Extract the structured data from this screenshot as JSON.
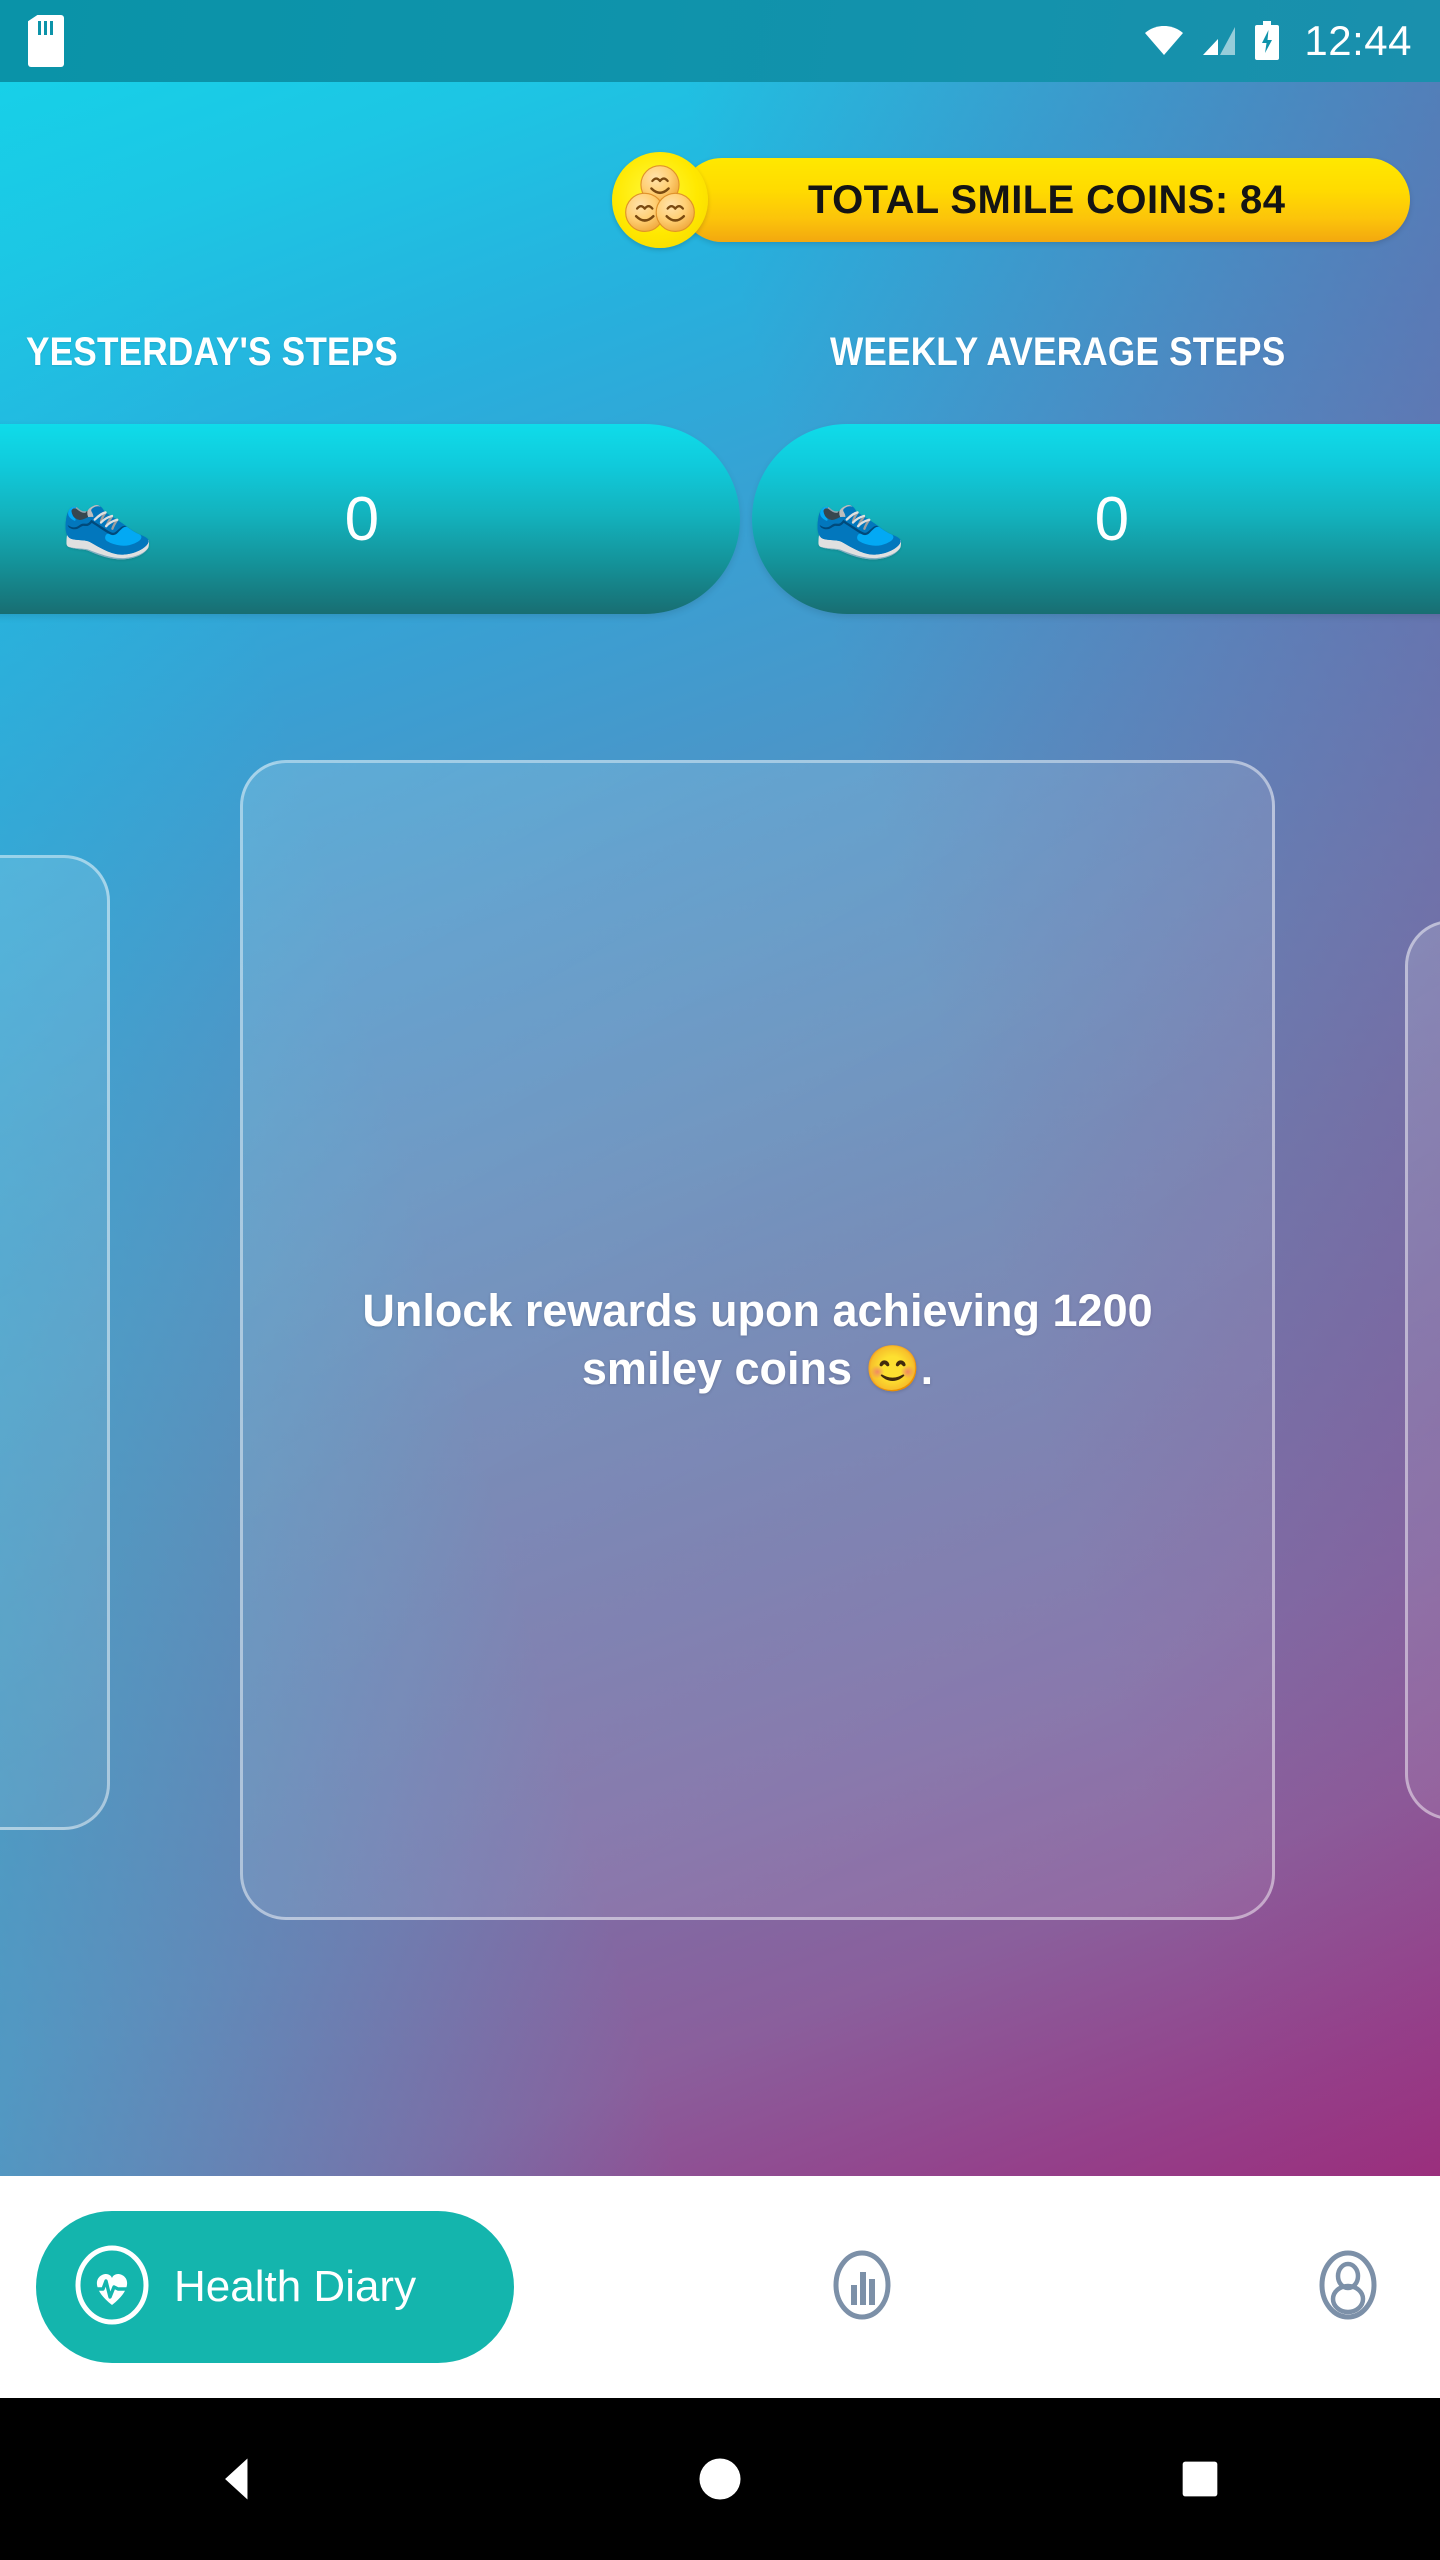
{
  "status_bar": {
    "sd_card_icon": "sd-card-icon",
    "wifi_icon": "wifi-icon",
    "signal_icon": "cellular-signal-icon",
    "battery_icon": "battery-charging-icon",
    "time": "12:44"
  },
  "coins": {
    "medallion_icon": "three-smileys-icon",
    "label": "TOTAL SMILE COINS: 84",
    "value": 84,
    "pill_color_start": "#ffe800",
    "pill_color_end": "#f3a80f",
    "text_color": "#141414"
  },
  "steps": {
    "yesterday": {
      "label": "YESTERDAY'S STEPS",
      "icon": "running-shoe-icon",
      "value": "0"
    },
    "weekly": {
      "label": "WEEKLY AVERAGE STEPS",
      "icon": "running-shoe-icon",
      "value": "0"
    },
    "card_color_start": "#0fdcea",
    "card_color_end": "#186e72"
  },
  "reward_card": {
    "message": "Unlock rewards upon achieving 1200 smiley coins 😊.",
    "goal_coins": 1200
  },
  "bottom_nav": {
    "items": [
      {
        "label": "Health Diary",
        "icon": "heart-pulse-icon",
        "active": true
      },
      {
        "label": "",
        "icon": "bar-chart-icon",
        "active": false
      },
      {
        "label": "",
        "icon": "profile-person-icon",
        "active": false
      }
    ],
    "active_color": "#14b5ad",
    "inactive_color": "#7c90a8"
  },
  "android_nav": {
    "back": "back-triangle-icon",
    "home": "home-circle-icon",
    "recents": "recents-square-icon"
  }
}
